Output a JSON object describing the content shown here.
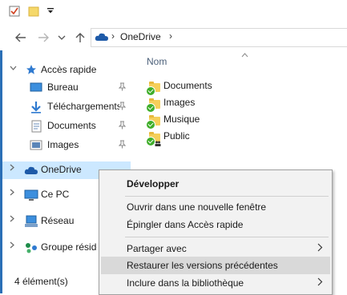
{
  "toolbar": {
    "icons": [
      "properties-icon",
      "new-folder-icon",
      "qat-dropdown-icon"
    ]
  },
  "address": {
    "path": [
      "OneDrive"
    ],
    "sort_icon": "chevron-up-icon"
  },
  "nav": {
    "quick_access": "Accès rapide",
    "items": [
      {
        "label": "Bureau",
        "icon": "desktop-icon"
      },
      {
        "label": "Téléchargements",
        "icon": "download-icon"
      },
      {
        "label": "Documents",
        "icon": "documents-icon"
      },
      {
        "label": "Images",
        "icon": "pictures-icon"
      }
    ],
    "onedrive": "OneDrive",
    "this_pc": "Ce PC",
    "network": "Réseau",
    "homegroup": "Groupe résidentiel"
  },
  "content": {
    "column_name": "Nom",
    "files": [
      "Documents",
      "Images",
      "Musique",
      "Public"
    ]
  },
  "status": {
    "count": "4 élément(s)"
  },
  "context_menu": {
    "expand": "Développer",
    "open_new_window": "Ouvrir dans une nouvelle fenêtre",
    "pin_quick_access": "Épingler dans Accès rapide",
    "share_with": "Partager avec",
    "restore_versions": "Restaurer les versions précédentes",
    "include_library": "Inclure dans la bibliothèque"
  },
  "colors": {
    "selection": "#cce8ff",
    "menu_bg": "#f2f2f2",
    "menu_highlight": "#d9d9d9",
    "onedrive_blue": "#1e5aa8",
    "frame_blue": "#2b6fb6"
  }
}
